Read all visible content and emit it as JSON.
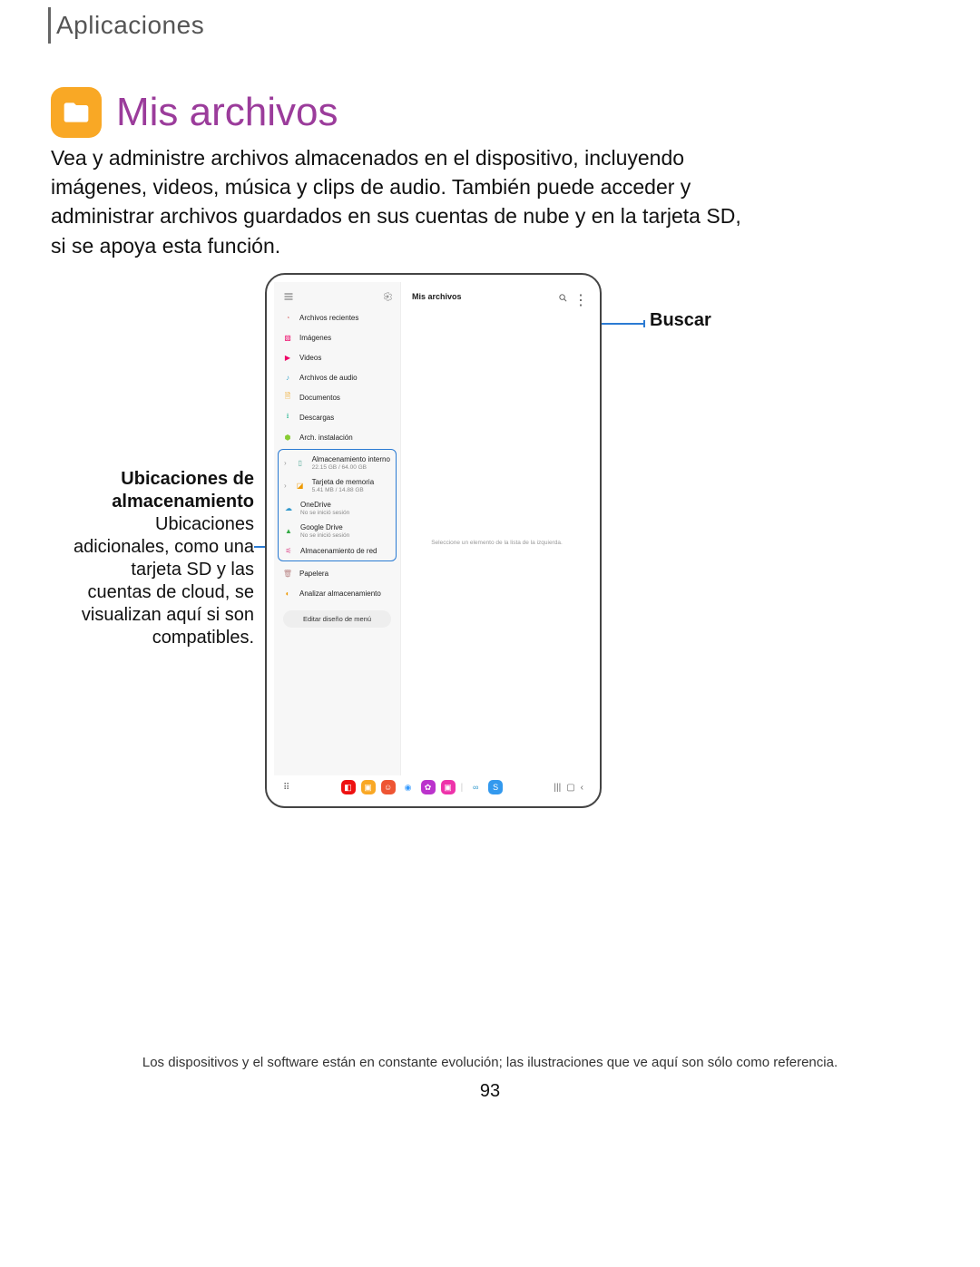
{
  "section": "Aplicaciones",
  "title": "Mis archivos",
  "body": "Vea y administre archivos almacenados en el dispositivo, incluyendo imágenes, videos, música y clips de audio. También puede acceder y administrar archivos guardados en sus cuentas de nube y en la tarjeta SD, si se apoya esta función.",
  "callouts": {
    "left_bold": "Ubicaciones de almacenamiento",
    "left_body": "Ubicaciones adicionales, como una tarjeta SD y las cuentas de cloud, se visualizan aquí si son compatibles.",
    "right": "Buscar"
  },
  "screenshot": {
    "header_title": "Mis archivos",
    "empty_hint": "Seleccione un elemento de la lista de la izquierda.",
    "sidebar": {
      "recent": "Archivos recientes",
      "images": "Imágenes",
      "videos": "Videos",
      "audio": "Archivos de audio",
      "docs": "Documentos",
      "downloads": "Descargas",
      "apk": "Arch. instalación",
      "internal": {
        "label": "Almacenamiento interno",
        "sub": "22.15 GB / 64.00 GB"
      },
      "sd": {
        "label": "Tarjeta de memoria",
        "sub": "5.41 MB / 14.88 GB"
      },
      "onedrive": {
        "label": "OneDrive",
        "sub": "No se inició sesión"
      },
      "gdrive": {
        "label": "Google Drive",
        "sub": "No se inició sesión"
      },
      "network": "Almacenamiento de red",
      "trash": "Papelera",
      "analyze": "Analizar almacenamiento",
      "edit_menu": "Editar diseño de menú"
    }
  },
  "footnote": "Los dispositivos y el software están en constante evolución; las ilustraciones que ve aquí son sólo como referencia.",
  "page_number": "93"
}
